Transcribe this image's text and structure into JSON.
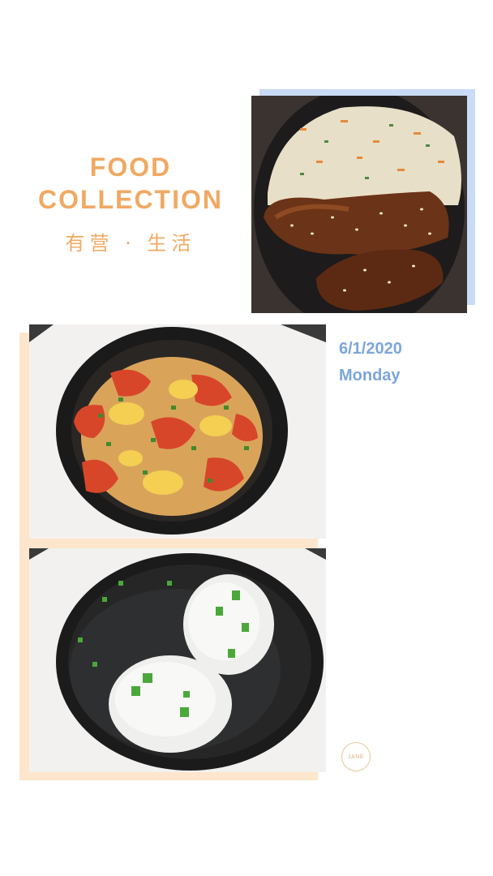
{
  "header": {
    "title_line1": "FOOD",
    "title_line2": "COLLECTION",
    "subtitle": "有营 · 生活"
  },
  "date": {
    "date": "6/1/2020",
    "weekday": "Monday"
  },
  "stamp": {
    "text": "JANE"
  },
  "photos": [
    {
      "subject": "bowl-rice-chicken-wings"
    },
    {
      "subject": "bowl-tomato-egg"
    },
    {
      "subject": "bowl-rice-balls-soup"
    }
  ],
  "colors": {
    "title": "#f0a962",
    "date": "#7ba6dc",
    "frame_blue": "#c9dbf5",
    "frame_peach": "#fde6cc",
    "stamp": "#e6c893"
  }
}
